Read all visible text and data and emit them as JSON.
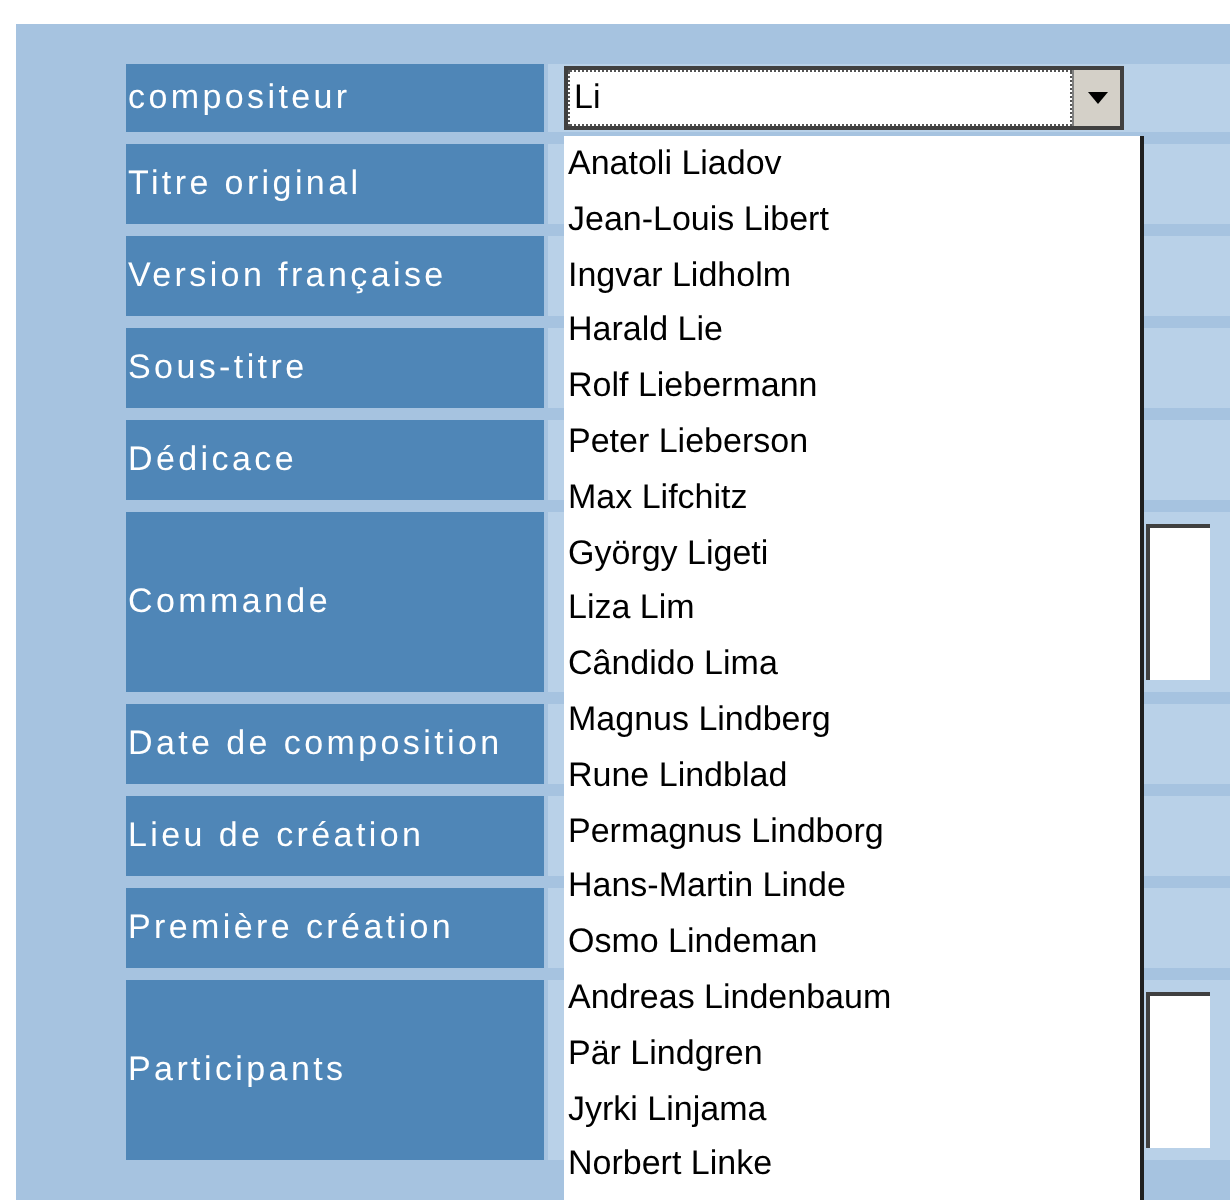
{
  "form": {
    "rows": [
      {
        "label": "compositeur",
        "kind": "combo"
      },
      {
        "label": "Titre original",
        "kind": "text"
      },
      {
        "label": "Version française",
        "kind": "text"
      },
      {
        "label": "Sous-titre",
        "kind": "text"
      },
      {
        "label": "Dédicace",
        "kind": "text"
      },
      {
        "label": "Commande",
        "kind": "textarea"
      },
      {
        "label": "Date de composition",
        "kind": "text"
      },
      {
        "label": "Lieu de création",
        "kind": "text"
      },
      {
        "label": "Première création",
        "kind": "text"
      },
      {
        "label": "Participants",
        "kind": "textarea"
      }
    ]
  },
  "combo": {
    "value": "Li",
    "expanded": true,
    "options": [
      "Anatoli Liadov",
      "Jean-Louis Libert",
      "Ingvar Lidholm",
      "Harald Lie",
      "Rolf Liebermann",
      "Peter Lieberson",
      "Max Lifchitz",
      "György Ligeti",
      "Liza Lim",
      "Cândido Lima",
      "Magnus Lindberg",
      "Rune Lindblad",
      "Permagnus Lindborg",
      "Hans-Martin Linde",
      "Osmo Lindeman",
      "Andreas Lindenbaum",
      "Pär Lindgren",
      "Jyrki Linjama",
      "Norbert Linke"
    ]
  }
}
